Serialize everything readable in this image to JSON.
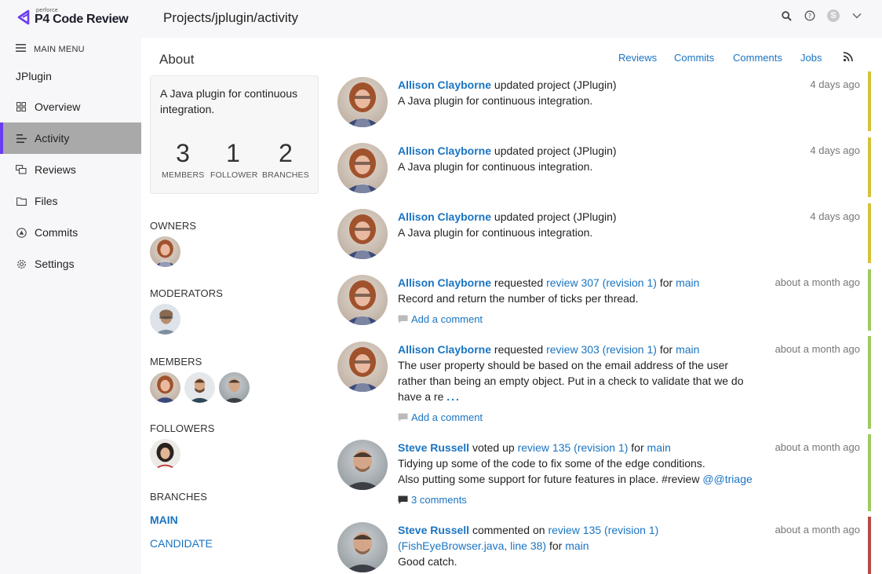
{
  "header": {
    "brand_small": "perforce",
    "brand_name": "P4 Code Review",
    "breadcrumb": "Projects/jplugin/activity",
    "user_initial": "S"
  },
  "sidebar": {
    "main_menu_label": "MAIN MENU",
    "project_name": "JPlugin",
    "items": [
      {
        "label": "Overview",
        "icon": "grid-icon"
      },
      {
        "label": "Activity",
        "icon": "activity-icon",
        "active": true
      },
      {
        "label": "Reviews",
        "icon": "reviews-icon"
      },
      {
        "label": "Files",
        "icon": "folder-icon"
      },
      {
        "label": "Commits",
        "icon": "commit-icon"
      },
      {
        "label": "Settings",
        "icon": "gear-icon"
      }
    ]
  },
  "about": {
    "title": "About",
    "description": "A Java plugin for continuous integration.",
    "stats": [
      {
        "num": "3",
        "label": "MEMBERS"
      },
      {
        "num": "1",
        "label": "FOLLOWER"
      },
      {
        "num": "2",
        "label": "BRANCHES"
      }
    ],
    "owners_label": "OWNERS",
    "moderators_label": "MODERATORS",
    "members_label": "MEMBERS",
    "followers_label": "FOLLOWERS",
    "branches_label": "BRANCHES",
    "branches": [
      "MAIN",
      "CANDIDATE"
    ]
  },
  "tabs": [
    "Reviews",
    "Commits",
    "Comments",
    "Jobs"
  ],
  "activity": [
    {
      "who": "Allison Clayborne",
      "action": " updated project (JPlugin)",
      "text": "A Java plugin for continuous integration.",
      "time": "4 days ago",
      "bar": "#d4c23a"
    },
    {
      "who": "Allison Clayborne",
      "action": " updated project (JPlugin)",
      "text": "A Java plugin for continuous integration.",
      "time": "4 days ago",
      "bar": "#d4c23a"
    },
    {
      "who": "Allison Clayborne",
      "action": " updated project (JPlugin)",
      "text": "A Java plugin for continuous integration.",
      "time": "4 days ago",
      "bar": "#d4c23a"
    },
    {
      "who": "Allison Clayborne",
      "action": " requested ",
      "review": "review 307 (revision 1)",
      "for": " for ",
      "branch": "main",
      "text": "Record and return the number of ticks per thread.",
      "comment": "Add a comment",
      "time": "about a month ago",
      "bar": "#9dcb5f"
    },
    {
      "who": "Allison Clayborne",
      "action": " requested ",
      "review": "review 303 (revision 1)",
      "for": " for ",
      "branch": "main",
      "text": "The user property should be based on the email address of the user rather than being an empty object. Put in a check to validate that we do have a re",
      "ellipsis": "...",
      "comment": "Add a comment",
      "time": "about a month ago",
      "bar": "#9dcb5f"
    },
    {
      "who": "Steve Russell",
      "action": " voted up ",
      "review": "review 135 (revision 1)",
      "for": " for ",
      "branch": "main",
      "text": "Tidying up some of the code to fix some of the edge conditions.",
      "text2": "Also putting some support for future features in place. #review ",
      "mention": "@@triage",
      "comment": "3 comments",
      "time": "about a month ago",
      "bar": "#9dcb5f"
    },
    {
      "who": "Steve Russell",
      "action": " commented on ",
      "review": "review 135 (revision 1)",
      "file": "(FishEyeBrowser.java, line 38)",
      "for": " for ",
      "branch": "main",
      "text": "Good catch.",
      "time": "about a month ago",
      "bar": "#b54a4a"
    }
  ]
}
